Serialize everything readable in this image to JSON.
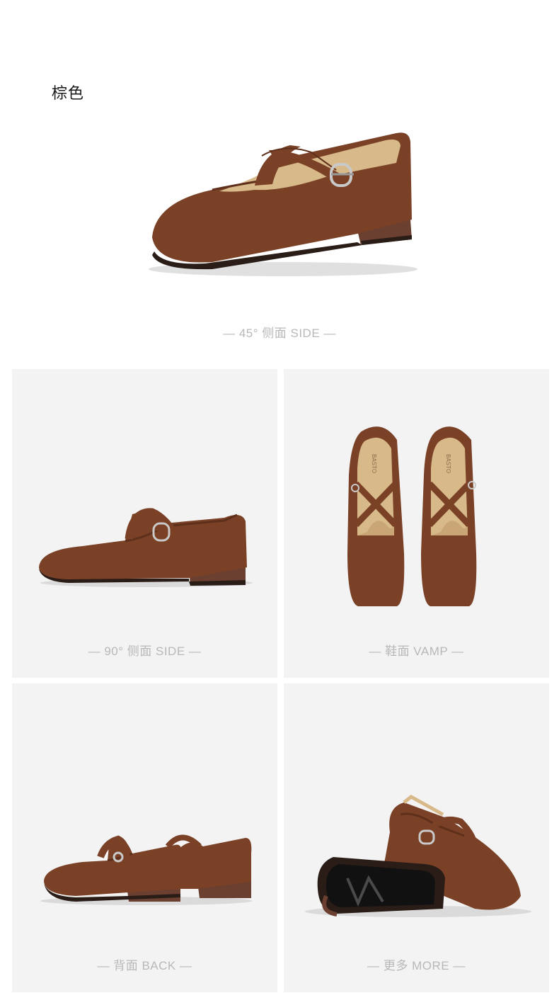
{
  "color_title": "棕色",
  "views": {
    "side45": "— 45°  侧面 SIDE —",
    "side90": "— 90°  侧面 SIDE —",
    "vamp": "— 鞋面 VAMP —",
    "back": "— 背面 BACK —",
    "more": "— 更多 MORE —"
  },
  "insole_brand": "BASTO",
  "colors": {
    "suede": "#7a4127",
    "suede_dark": "#5e301c",
    "lining": "#d8b98a",
    "sole": "#2a1c16",
    "heel": "#6b4030",
    "panel_bg": "#f3f3f3",
    "caption": "#b8b8b8"
  }
}
